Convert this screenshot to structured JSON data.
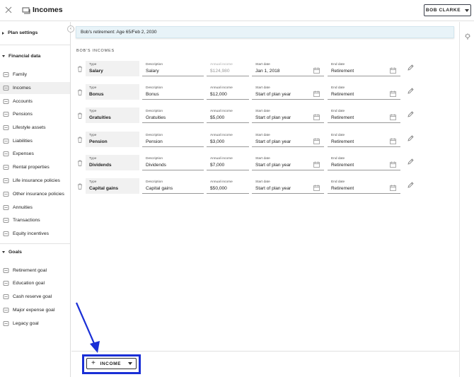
{
  "header": {
    "title": "Incomes",
    "user_button": "BOB CLARKE"
  },
  "sidebar": {
    "plan_settings": "Plan settings",
    "financial_data": "Financial data",
    "financial_items": [
      {
        "label": "Family",
        "icon": "family-icon"
      },
      {
        "label": "Incomes",
        "icon": "incomes-icon"
      },
      {
        "label": "Accounts",
        "icon": "accounts-icon"
      },
      {
        "label": "Pensions",
        "icon": "pensions-icon"
      },
      {
        "label": "Lifestyle assets",
        "icon": "lifestyle-assets-icon"
      },
      {
        "label": "Liabilities",
        "icon": "liabilities-icon"
      },
      {
        "label": "Expenses",
        "icon": "expenses-icon"
      },
      {
        "label": "Rental properties",
        "icon": "rental-properties-icon"
      },
      {
        "label": "Life insurance policies",
        "icon": "life-insurance-icon"
      },
      {
        "label": "Other insurance policies",
        "icon": "other-insurance-icon"
      },
      {
        "label": "Annuities",
        "icon": "annuities-icon"
      },
      {
        "label": "Transactions",
        "icon": "transactions-icon"
      },
      {
        "label": "Equity incentives",
        "icon": "equity-incentives-icon"
      }
    ],
    "goals": "Goals",
    "goal_items": [
      {
        "label": "Retirement goal",
        "icon": "retirement-goal-icon"
      },
      {
        "label": "Education goal",
        "icon": "education-goal-icon"
      },
      {
        "label": "Cash reserve goal",
        "icon": "cash-reserve-goal-icon"
      },
      {
        "label": "Major expense goal",
        "icon": "major-expense-goal-icon"
      },
      {
        "label": "Legacy goal",
        "icon": "legacy-goal-icon"
      }
    ]
  },
  "banner": "Bob's retirement: Age 65/Feb 2, 2030",
  "section_title": "BOB'S INCOMES",
  "field_labels": {
    "type": "Type",
    "description": "Description",
    "annual_income": "Annual income",
    "start_date": "Start date",
    "end_date": "End date"
  },
  "incomes": [
    {
      "type": "Salary",
      "description": "Salary",
      "annual_income": "$124,980",
      "start_date": "Jan 1, 2018",
      "end_date": "Retirement"
    },
    {
      "type": "Bonus",
      "description": "Bonus",
      "annual_income": "$12,000",
      "start_date": "Start of plan year",
      "end_date": "Retirement"
    },
    {
      "type": "Gratuities",
      "description": "Gratuities",
      "annual_income": "$5,000",
      "start_date": "Start of plan year",
      "end_date": "Retirement"
    },
    {
      "type": "Pension",
      "description": "Pension",
      "annual_income": "$3,000",
      "start_date": "Start of plan year",
      "end_date": "Retirement"
    },
    {
      "type": "Dividends",
      "description": "Dividends",
      "annual_income": "$7,000",
      "start_date": "Start of plan year",
      "end_date": "Retirement"
    },
    {
      "type": "Capital gains",
      "description": "Capital gains",
      "annual_income": "$50,000",
      "start_date": "Start of plan year",
      "end_date": "Retirement"
    }
  ],
  "add_button": "INCOME",
  "colors": {
    "highlight": "#1a2fd6",
    "banner_bg": "#e8f3f8",
    "active_nav": "#f0f0f0"
  }
}
